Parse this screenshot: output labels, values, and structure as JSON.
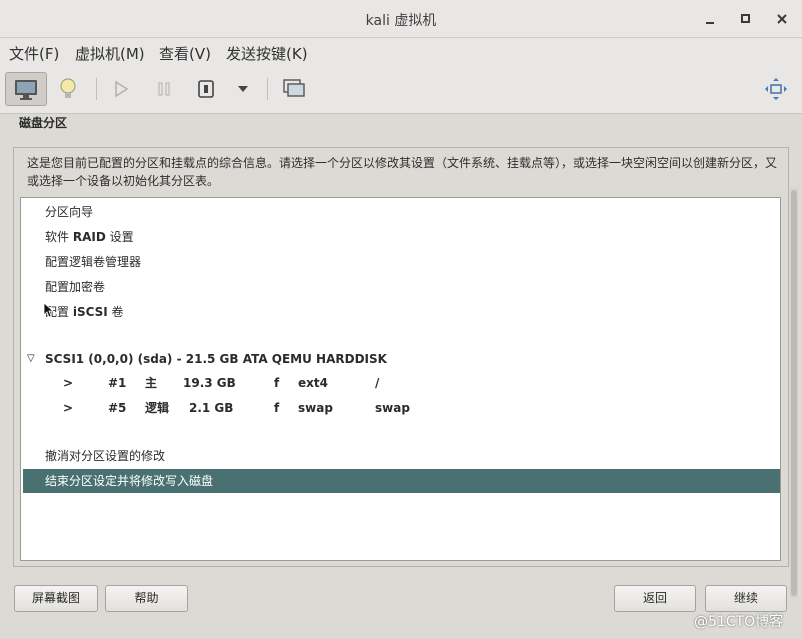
{
  "window": {
    "title": "kali 虚拟机"
  },
  "menubar": {
    "items": [
      "文件(F)",
      "虚拟机(M)",
      "查看(V)",
      "发送按键(K)"
    ]
  },
  "installer": {
    "section_title": "磁盘分区",
    "help_text": "这是您目前已配置的分区和挂载点的综合信息。请选择一个分区以修改其设置（文件系统、挂载点等），或选择一块空闲空间以创建新分区，又或选择一个设备以初始化其分区表。",
    "options": [
      {
        "prefix": "分区向导",
        "bold": "",
        "suffix": ""
      },
      {
        "prefix": "软件 ",
        "bold": "RAID",
        "suffix": " 设置"
      },
      {
        "prefix": "配置逻辑卷管理器",
        "bold": "",
        "suffix": ""
      },
      {
        "prefix": "配置加密卷",
        "bold": "",
        "suffix": ""
      },
      {
        "prefix": "配置 ",
        "bold": "iSCSI",
        "suffix": " 卷"
      }
    ],
    "disk": {
      "arrow": "▽",
      "label": "SCSI1 (0,0,0) (sda) - 21.5 GB ATA QEMU HARDDISK",
      "partitions": [
        {
          "marker": ">",
          "number": "#1",
          "type": "主",
          "size": "19.3 GB",
          "flag": "f",
          "fs": "ext4",
          "mount": "/"
        },
        {
          "marker": ">",
          "number": "#5",
          "type": "逻辑",
          "size": "2.1 GB",
          "flag": "f",
          "fs": "swap",
          "mount": "swap"
        }
      ]
    },
    "undo_label": "撤消对分区设置的修改",
    "finish_label": "结束分区设定并将修改写入磁盘"
  },
  "buttons": {
    "screenshot": "屏幕截图",
    "help": "帮助",
    "back": "返回",
    "continue": "继续"
  },
  "watermark": "@51CTO博客"
}
